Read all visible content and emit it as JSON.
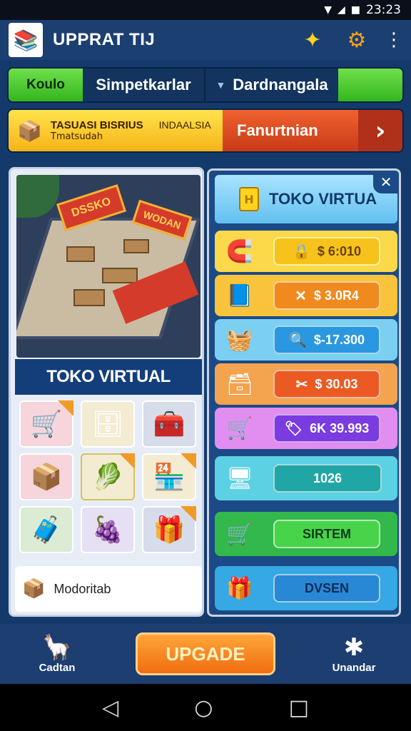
{
  "status_bar": {
    "time": "23:23",
    "icons": [
      "wifi-icon",
      "signal-icon",
      "battery-icon"
    ]
  },
  "header": {
    "title": "UPPRAT TIJ",
    "logo_icon": "books-icon",
    "icons": [
      "star-icon",
      "gear-icon",
      "more-vert-icon"
    ]
  },
  "tabs": [
    {
      "label": "Koulo"
    },
    {
      "label": "Simpetkarlar"
    },
    {
      "label": "Dardnangala"
    },
    {
      "label": ""
    }
  ],
  "banner": {
    "title": "TASUASI BISRIUS",
    "tag": "INDAALSIA",
    "subtitle": "Tmatsudah",
    "action_label": "Fanurtnian"
  },
  "left_panel": {
    "scene_sign_1": "DSSKO",
    "scene_sign_2": "WODAN",
    "heading": "TOKO VIRTUAL",
    "grid_items": [
      {
        "icon": "stall-icon"
      },
      {
        "icon": "shelf-icon"
      },
      {
        "icon": "counter-icon"
      },
      {
        "icon": "box-stall-icon"
      },
      {
        "icon": "produce-stall-icon"
      },
      {
        "icon": "kiosk-icon"
      },
      {
        "icon": "chest-icon"
      },
      {
        "icon": "fruit-icon"
      },
      {
        "icon": "stack-icon"
      }
    ],
    "bottom_slot_label": "Modoritab"
  },
  "right_panel": {
    "title": "TOKO VIRTUA",
    "rows": [
      {
        "icon": "tape-icon",
        "pill_icon": "lock-icon",
        "value": "$ 6:010"
      },
      {
        "icon": "book-icon",
        "pill_icon": "cross-icon",
        "value": "$ 3.0R4"
      },
      {
        "icon": "crate-icon",
        "pill_icon": "search-icon",
        "value": "$-17.300"
      },
      {
        "icon": "package-icon",
        "pill_icon": "tool-icon",
        "value": "$ 30.03"
      },
      {
        "icon": "cart-icon",
        "pill_icon": "tag-icon",
        "value": "6K 39.993"
      },
      {
        "icon": "register-icon",
        "pill_icon": "",
        "value": "1026"
      },
      {
        "icon": "trolley-icon",
        "pill_icon": "",
        "value": "SIRTEM"
      },
      {
        "icon": "gift-icon",
        "pill_icon": "",
        "value": "DVSEN"
      }
    ]
  },
  "bottom_bar": {
    "left_label": "Cadtan",
    "center_label": "UPGADE",
    "right_label": "Unandar"
  },
  "colors": {
    "accent": "#f06d10",
    "header_bg": "#1c3f72",
    "tab_green": "#34b51e"
  }
}
